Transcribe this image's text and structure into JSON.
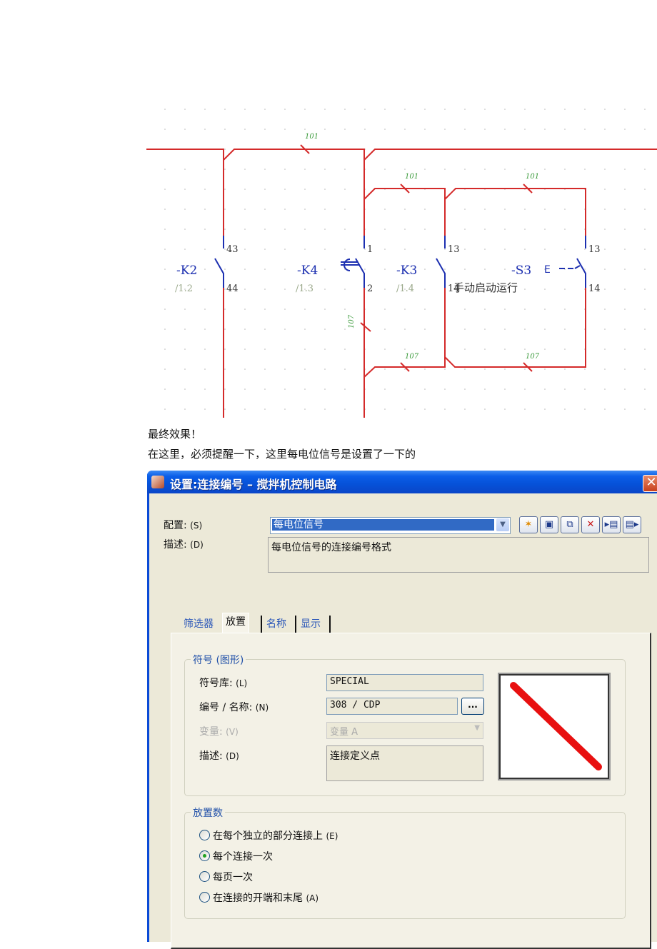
{
  "schematic": {
    "wire_color": "#d42a2a",
    "contact_color": "#1c2fb0",
    "wire_labels": [
      "101",
      "101",
      "101",
      "107",
      "107",
      "107"
    ],
    "devices": [
      {
        "tag": "-K2",
        "ref": "/1.2",
        "pin_top": "43",
        "pin_bottom": "44"
      },
      {
        "tag": "-K4",
        "ref": "/1.3",
        "pin_top": "1",
        "pin_bottom": "2"
      },
      {
        "tag": "-K3",
        "ref": "/1.4",
        "pin_top": "13",
        "pin_bottom": "14"
      },
      {
        "tag": "-S3",
        "ref": "",
        "pin_top": "13",
        "pin_bottom": "14"
      }
    ],
    "function_text": "手动启动运行",
    "s3_actuator": "E---"
  },
  "captions": {
    "line1": "最终效果！",
    "line2": "在这里，必须提醒一下，这里每电位信号是设置了一下的"
  },
  "dialog": {
    "title": "设置:连接编号 – 搅拌机控制电路",
    "close_label": "✕",
    "config_label": "配置:",
    "config_mnemonic": "(S)",
    "config_value": "每电位信号",
    "desc_label": "描述:",
    "desc_mnemonic": "(D)",
    "desc_value": "每电位信号的连接编号格式",
    "toolbar_icons": [
      "new-icon",
      "save-icon",
      "copy-icon",
      "delete-icon",
      "import-icon",
      "export-icon"
    ],
    "tabs": [
      {
        "label": "筛选器",
        "active": false
      },
      {
        "label": "放置",
        "active": true
      },
      {
        "label": "名称",
        "active": false
      },
      {
        "label": "显示",
        "active": false
      }
    ],
    "symbol_group": {
      "title": "符号 (图形)",
      "library_label": "符号库:",
      "library_mnemonic": "(L)",
      "library_value": "SPECIAL",
      "number_label": "编号 / 名称:",
      "number_mnemonic": "(N)",
      "number_value": "308 / CDP",
      "browse_label": "...",
      "variant_label": "变量:",
      "variant_mnemonic": "(V)",
      "variant_value": "变量 A",
      "desc_label": "描述:",
      "desc_mnemonic": "(D)",
      "desc_value": "连接定义点"
    },
    "placement_group": {
      "title": "放置数",
      "options": [
        {
          "label": "在每个独立的部分连接上",
          "mnemonic": "(E)",
          "selected": false
        },
        {
          "label": "每个连接一次",
          "mnemonic": "",
          "selected": true
        },
        {
          "label": "每页一次",
          "mnemonic": "",
          "selected": false
        },
        {
          "label": "在连接的开端和末尾",
          "mnemonic": "(A)",
          "selected": false
        }
      ]
    }
  }
}
